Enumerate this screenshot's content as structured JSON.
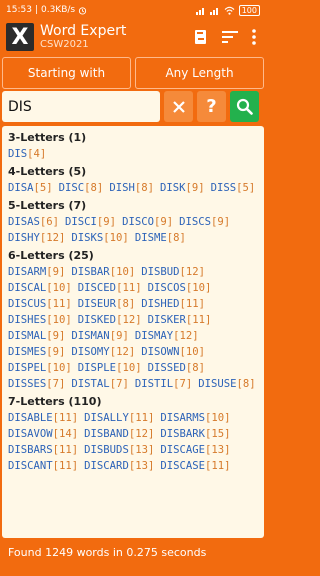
{
  "status_bar": {
    "time": "15:53",
    "speed": "0.3KB/s",
    "battery": "100"
  },
  "app": {
    "title": "Word Expert",
    "subtitle": "CSW2021",
    "logo": "X"
  },
  "icons": [
    "book-icon",
    "sort-icon",
    "more-vertical-icon",
    "clear-icon",
    "help-icon",
    "search-icon"
  ],
  "mode": {
    "starting_with": "Starting with",
    "length": "Any Length"
  },
  "search": {
    "value": "DIS",
    "help_label": "?"
  },
  "colors": {
    "accent": "#f26b0f",
    "word_prefix": "#2d63b8",
    "score": "#d67a2b",
    "panel": "#fff8e7",
    "search_green": "#23b14d"
  },
  "results": [
    {
      "title": "3-Letters (1)",
      "words": [
        [
          "DIS",
          "[4]"
        ]
      ]
    },
    {
      "title": "4-Letters (5)",
      "words": [
        [
          "DISA",
          "[5]"
        ],
        [
          "DISC",
          "[8]"
        ],
        [
          "DISH",
          "[8]"
        ],
        [
          "DISK",
          "[9]"
        ],
        [
          "DISS",
          "[5]"
        ]
      ]
    },
    {
      "title": "5-Letters (7)",
      "words": [
        [
          "DISAS",
          "[6]"
        ],
        [
          "DISCI",
          "[9]"
        ],
        [
          "DISCO",
          "[9]"
        ],
        [
          "DISCS",
          "[9]"
        ],
        [
          "DISHY",
          "[12]"
        ],
        [
          "DISKS",
          "[10]"
        ],
        [
          "DISME",
          "[8]"
        ]
      ]
    },
    {
      "title": "6-Letters (25)",
      "words": [
        [
          "DISARM",
          "[9]"
        ],
        [
          "DISBAR",
          "[10]"
        ],
        [
          "DISBUD",
          "[12]"
        ],
        [
          "DISCAL",
          "[10]"
        ],
        [
          "DISCED",
          "[11]"
        ],
        [
          "DISCOS",
          "[10]"
        ],
        [
          "DISCUS",
          "[11]"
        ],
        [
          "DISEUR",
          "[8]"
        ],
        [
          "DISHED",
          "[11]"
        ],
        [
          "DISHES",
          "[10]"
        ],
        [
          "DISKED",
          "[12]"
        ],
        [
          "DISKER",
          "[11]"
        ],
        [
          "DISMAL",
          "[9]"
        ],
        [
          "DISMAN",
          "[9]"
        ],
        [
          "DISMAY",
          "[12]"
        ],
        [
          "DISMES",
          "[9]"
        ],
        [
          "DISOMY",
          "[12]"
        ],
        [
          "DISOWN",
          "[10]"
        ],
        [
          "DISPEL",
          "[10]"
        ],
        [
          "DISPLE",
          "[10]"
        ],
        [
          "DISSED",
          "[8]"
        ],
        [
          "DISSES",
          "[7]"
        ],
        [
          "DISTAL",
          "[7]"
        ],
        [
          "DISTIL",
          "[7]"
        ],
        [
          "DISUSE",
          "[8]"
        ]
      ]
    },
    {
      "title": "7-Letters (110)",
      "words": [
        [
          "DISABLE",
          "[11]"
        ],
        [
          "DISALLY",
          "[11]"
        ],
        [
          "DISARMS",
          "[10]"
        ],
        [
          "DISAVOW",
          "[14]"
        ],
        [
          "DISBAND",
          "[12]"
        ],
        [
          "DISBARK",
          "[15]"
        ],
        [
          "DISBARS",
          "[11]"
        ],
        [
          "DISBUDS",
          "[13]"
        ],
        [
          "DISCAGE",
          "[13]"
        ],
        [
          "DISCANT",
          "[11]"
        ],
        [
          "DISCARD",
          "[13]"
        ],
        [
          "DISCASE",
          "[11]"
        ]
      ]
    }
  ],
  "footer": {
    "summary": "Found 1249 words in 0.275 seconds"
  }
}
